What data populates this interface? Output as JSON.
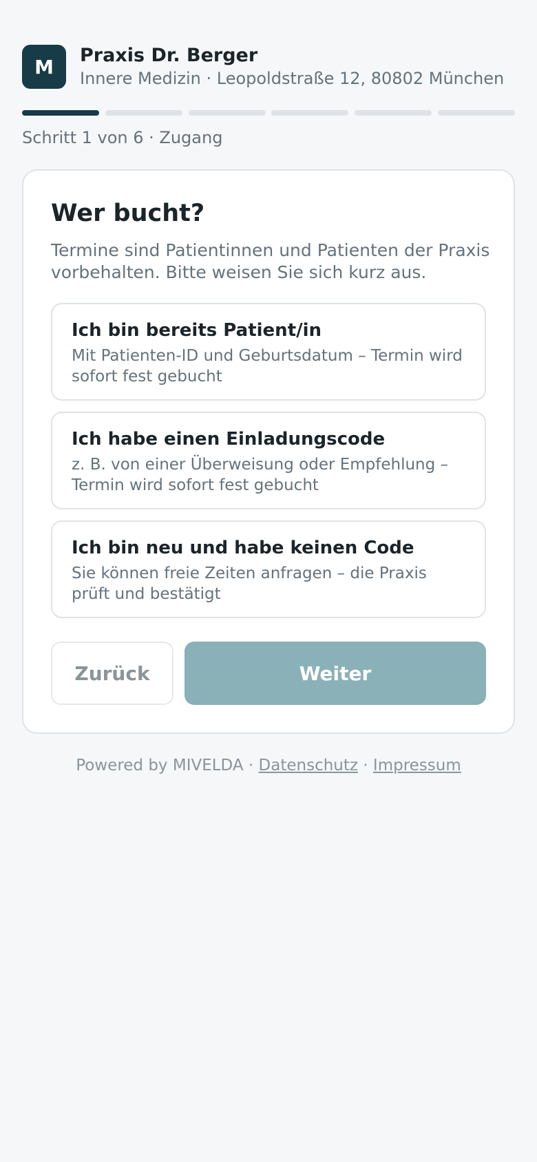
{
  "header": {
    "logo_letter": "M",
    "title": "Praxis Dr. Berger",
    "subtitle": "Innere Medizin · Leopoldstraße 12, 80802 München"
  },
  "progress": {
    "current_step": 1,
    "total_steps": 6,
    "label": "Schritt 1 von 6 · Zugang"
  },
  "card": {
    "title": "Wer bucht?",
    "description": "Termine sind Patientinnen und Patienten der Praxis vorbehalten. Bitte weisen Sie sich kurz aus.",
    "options": [
      {
        "title": "Ich bin bereits Patient/in",
        "description": "Mit Patienten-ID und Geburtsdatum – Termin wird sofort fest gebucht"
      },
      {
        "title": "Ich habe einen Einladungscode",
        "description": "z. B. von einer Überweisung oder Empfehlung – Termin wird sofort fest gebucht"
      },
      {
        "title": "Ich bin neu und habe keinen Code",
        "description": "Sie können freie Zeiten anfragen – die Praxis prüft und bestätigt"
      }
    ],
    "back_label": "Zurück",
    "next_label": "Weiter"
  },
  "footer": {
    "powered_by": "Powered by MIVELDA",
    "separator": " · ",
    "privacy_link": "Datenschutz",
    "imprint_link": "Impressum"
  },
  "colors": {
    "brand": "#173b47",
    "button_disabled": "#8ab0b8",
    "background": "#f5f7f9"
  }
}
